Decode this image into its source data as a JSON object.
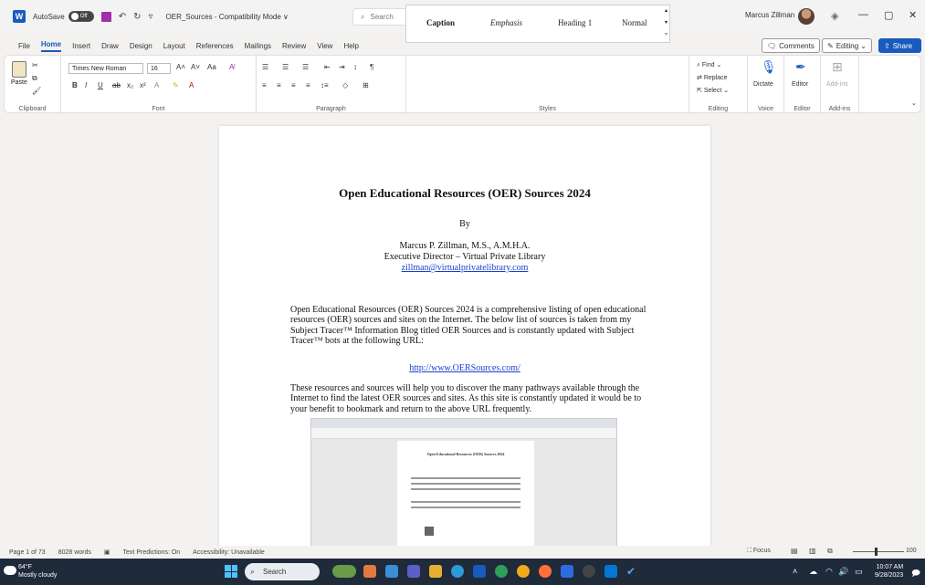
{
  "titlebar": {
    "autosave_label": "AutoSave",
    "autosave_state": "Off",
    "doc_title": "OER_Sources  -  Compatibility Mode  ∨",
    "search_placeholder": "Search",
    "user_name": "Marcus Zillman"
  },
  "menu": {
    "items": [
      "File",
      "Home",
      "Insert",
      "Draw",
      "Design",
      "Layout",
      "References",
      "Mailings",
      "Review",
      "View",
      "Help"
    ],
    "comments": "Comments",
    "editing": "Editing",
    "share": "Share"
  },
  "ribbon": {
    "clipboard_label": "Clipboard",
    "paste": "Paste",
    "font_name": "Times New Roman",
    "font_size": "16",
    "font_label": "Font",
    "paragraph_label": "Paragraph",
    "styles": [
      "Caption",
      "Emphasis",
      "Heading 1",
      "Normal"
    ],
    "styles_label": "Styles",
    "find": "Find",
    "replace": "Replace",
    "select": "Select",
    "editing_label": "Editing",
    "dictate": "Dictate",
    "voice_label": "Voice",
    "editor": "Editor",
    "editor_label": "Editor",
    "addins": "Add-ins",
    "addins_label": "Add-ins"
  },
  "document": {
    "title": "Open Educational Resources (OER) Sources 2024",
    "by": "By",
    "author": "Marcus P. Zillman, M.S., A.M.H.A.",
    "position": "Executive Director – Virtual Private Library",
    "email": "zillman@virtualprivatelibrary.com",
    "para1": "Open Educational Resources (OER) Sources 2024 is a comprehensive listing of open educational resources (OER) sources and sites on the Internet. The below list of sources is taken from my Subject Tracer™ Information Blog titled OER Sources and is constantly updated with Subject Tracer™ bots at the following URL:",
    "url": "http://www.OERSources.com/",
    "para2": "These resources and sources will help you to discover the many pathways available through the Internet to find the latest OER sources and sites. As this site is constantly updated it would be to your benefit to bookmark and return to the above URL frequently.",
    "embedded_title": "Open Educational Resources (OER) Sources 2024"
  },
  "statusbar": {
    "page": "Page 1 of 73",
    "words": "8028 words",
    "predictions": "Text Predictions: On",
    "accessibility": "Accessibility: Unavailable",
    "focus": "Focus",
    "zoom": "100"
  },
  "taskbar": {
    "temp": "64°F",
    "weather": "Mostly cloudy",
    "search": "Search",
    "time": "10:07 AM",
    "date": "9/28/2023"
  }
}
